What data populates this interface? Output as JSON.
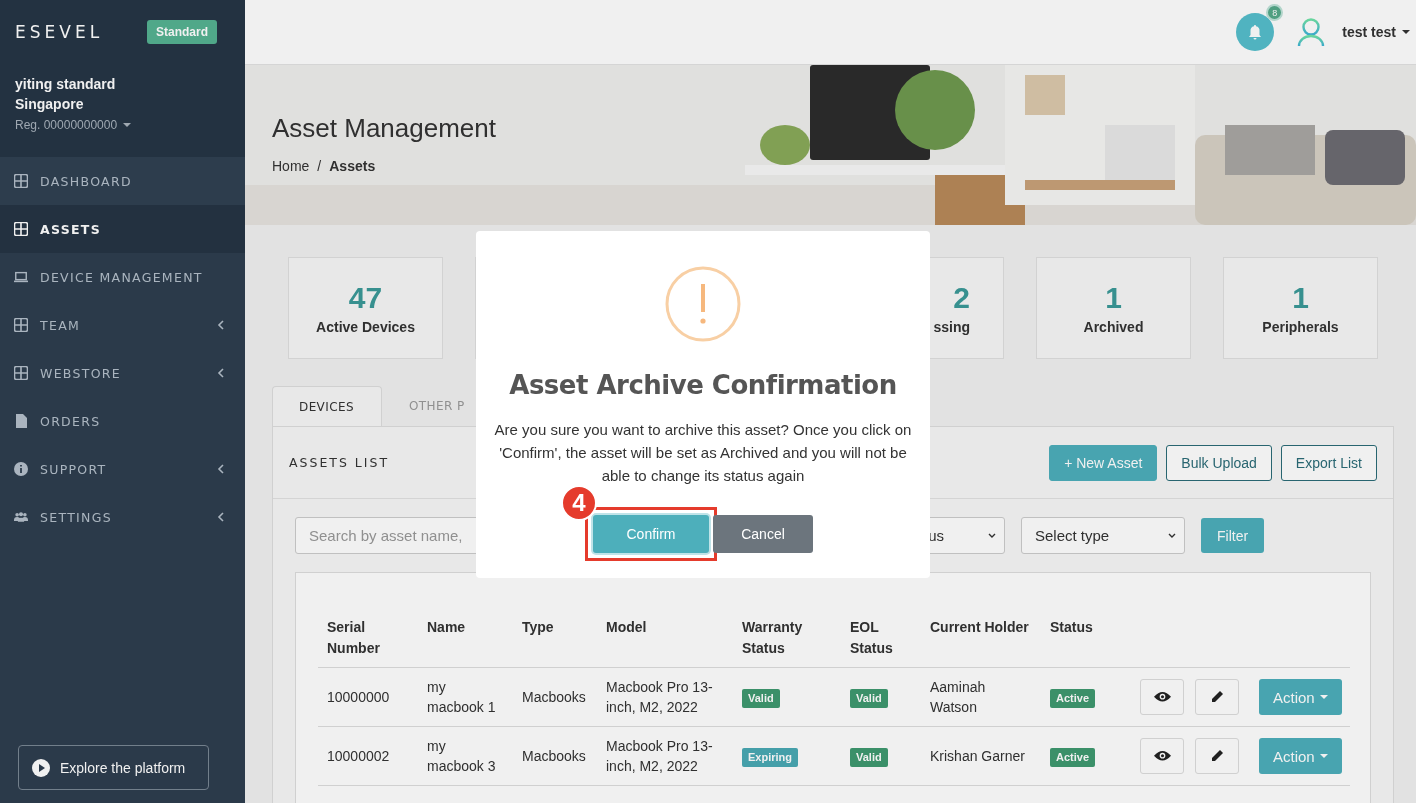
{
  "sidebar": {
    "brand": "ESEVEL",
    "plan": "Standard",
    "company_name": "yiting standard",
    "company_location": "Singapore",
    "registration": "Reg. 00000000000",
    "items": [
      {
        "label": "DASHBOARD",
        "kind": "grid",
        "selected": false,
        "expandable": false
      },
      {
        "label": "ASSETS",
        "kind": "grid",
        "selected": true,
        "expandable": false
      },
      {
        "label": "DEVICE MANAGEMENT",
        "kind": "laptop",
        "selected": false,
        "expandable": false
      },
      {
        "label": "TEAM",
        "kind": "grid",
        "selected": false,
        "expandable": true
      },
      {
        "label": "WEBSTORE",
        "kind": "grid",
        "selected": false,
        "expandable": true
      },
      {
        "label": "ORDERS",
        "kind": "file",
        "selected": false,
        "expandable": false
      },
      {
        "label": "SUPPORT",
        "kind": "info",
        "selected": false,
        "expandable": true
      },
      {
        "label": "SETTINGS",
        "kind": "users",
        "selected": false,
        "expandable": true
      }
    ],
    "explore_button": "Explore the platform"
  },
  "header": {
    "notification_count": "8",
    "user_name": "test test"
  },
  "page": {
    "title": "Asset Management",
    "breadcrumb_separator": "/",
    "breadcrumb": [
      {
        "label": "Home",
        "current": false
      },
      {
        "label": "Assets",
        "current": true
      }
    ]
  },
  "stats": [
    {
      "value": "47",
      "label": "Active Devices",
      "kind": "full"
    },
    {
      "value": "2",
      "label": "ssing",
      "kind": "partial"
    },
    {
      "value": "1",
      "label": "Archived",
      "kind": "full"
    },
    {
      "value": "1",
      "label": "Peripherals",
      "kind": "full"
    }
  ],
  "tabs": [
    {
      "label": "DEVICES",
      "selected": true
    },
    {
      "label": "OTHER P",
      "selected": false
    }
  ],
  "assets_list": {
    "title": "ASSETS LIST",
    "buttons": [
      {
        "label": "+ New Asset",
        "kind": "primary"
      },
      {
        "label": "Bulk Upload",
        "kind": "outline"
      },
      {
        "label": "Export List",
        "kind": "outline"
      }
    ]
  },
  "filters": {
    "search_placeholder": "Search by asset name,",
    "status_select": "us",
    "type_select": "Select type",
    "filter_button": "Filter"
  },
  "table": {
    "columns": [
      "Serial Number",
      "Name",
      "Type",
      "Model",
      "Warranty Status",
      "EOL Status",
      "Current Holder",
      "Status"
    ],
    "rows": [
      {
        "serial": "10000000",
        "name": "my macbook 1",
        "type": "Macbooks",
        "model": "Macbook Pro 13-inch, M2, 2022",
        "warranty": {
          "label": "Valid",
          "color": "#3f9a70"
        },
        "eol": {
          "label": "Valid",
          "color": "#3f9a70"
        },
        "holder": "Aaminah Watson",
        "status": {
          "label": "Active",
          "color": "#3f9a70"
        },
        "action": "Action"
      },
      {
        "serial": "10000002",
        "name": "my macbook 3",
        "type": "Macbooks",
        "model": "Macbook Pro 13-inch, M2, 2022",
        "warranty": {
          "label": "Expiring",
          "color": "#4aa9b4"
        },
        "eol": {
          "label": "Valid",
          "color": "#3f9a70"
        },
        "holder": "Krishan Garner",
        "status": {
          "label": "Active",
          "color": "#3f9a70"
        },
        "action": "Action"
      }
    ]
  },
  "modal": {
    "title": "Asset Archive Confirmation",
    "message": "Are you sure you want to archive this asset? Once you click on 'Confirm', the asset will be set as Archived and you will not be able to change its status again",
    "buttons": [
      {
        "label": "Confirm",
        "kind": "primary",
        "highlighted": true
      },
      {
        "label": "Cancel",
        "kind": "secondary",
        "highlighted": false
      }
    ],
    "step": "4"
  }
}
